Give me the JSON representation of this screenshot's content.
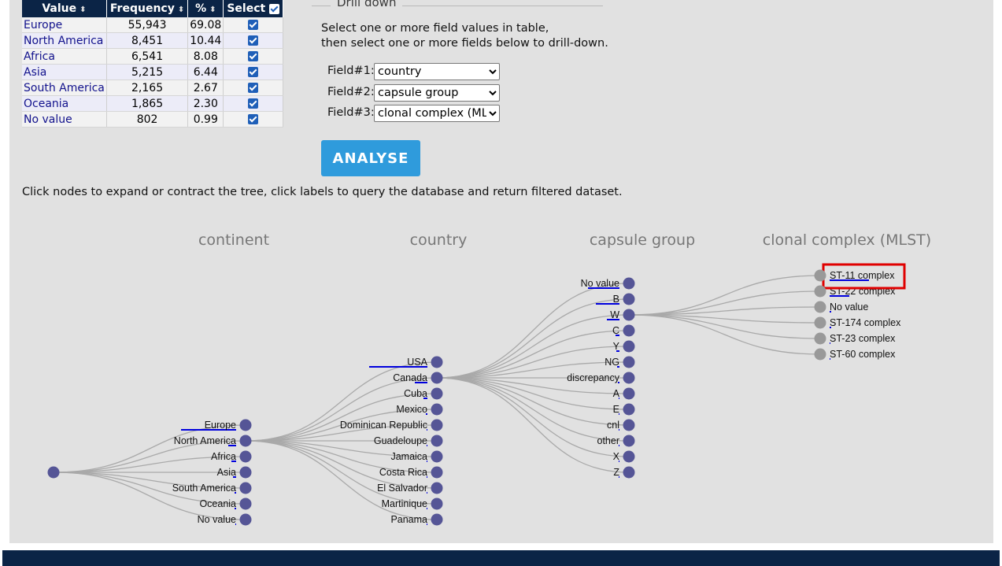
{
  "table": {
    "headers": {
      "value": "Value",
      "frequency": "Frequency",
      "percent": "%",
      "select": "Select"
    },
    "rows": [
      {
        "value": "Europe",
        "frequency": "55,943",
        "percent": "69.08"
      },
      {
        "value": "North America",
        "frequency": "8,451",
        "percent": "10.44"
      },
      {
        "value": "Africa",
        "frequency": "6,541",
        "percent": "8.08"
      },
      {
        "value": "Asia",
        "frequency": "5,215",
        "percent": "6.44"
      },
      {
        "value": "South America",
        "frequency": "2,165",
        "percent": "2.67"
      },
      {
        "value": "Oceania",
        "frequency": "1,865",
        "percent": "2.30"
      },
      {
        "value": "No value",
        "frequency": "802",
        "percent": "0.99"
      }
    ]
  },
  "drilldown": {
    "legend": "Drill down",
    "instruction_line1": "Select one or more field values in table,",
    "instruction_line2": "then select one or more fields below to drill-down.",
    "field1_label": "Field#1:",
    "field1_value": "country",
    "field2_label": "Field#2:",
    "field2_value": "capsule group",
    "field3_label": "Field#3:",
    "field3_value": "clonal complex (MLST)",
    "analyse_label": "ANALYSE"
  },
  "help_text": "Click nodes to expand or contract the tree, click labels to query the database and return filtered dataset.",
  "tree": {
    "level_titles": [
      "continent",
      "country",
      "capsule group",
      "clonal complex (MLST)"
    ],
    "continents": [
      "Europe",
      "North America",
      "Africa",
      "Asia",
      "South America",
      "Oceania",
      "No value"
    ],
    "countries": [
      "USA",
      "Canada",
      "Cuba",
      "Mexico",
      "Dominican Republic",
      "Guadeloupe",
      "Jamaica",
      "Costa Rica",
      "El Salvador",
      "Martinique",
      "Panama"
    ],
    "capsule_groups": [
      "No value",
      "B",
      "W",
      "C",
      "Y",
      "NG",
      "discrepancy",
      "A",
      "E",
      "cnl",
      "other",
      "X",
      "Z"
    ],
    "clonal_complexes": [
      "ST-11 complex",
      "ST-22 complex",
      "No value",
      "ST-174 complex",
      "ST-23 complex",
      "ST-60 complex"
    ],
    "colors": {
      "expanded_node": "#555596",
      "leaf_node": "#999999",
      "link": "#a9a9a9",
      "bar": "#0000dd",
      "highlight": "#e00000"
    }
  }
}
